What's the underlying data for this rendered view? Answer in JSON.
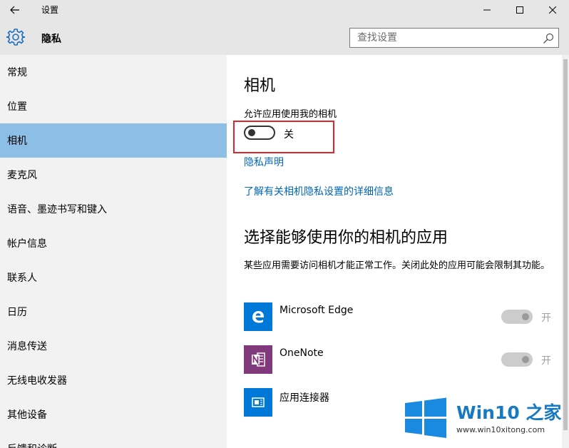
{
  "window": {
    "title": "设置",
    "icons": {
      "back": "back-arrow-icon",
      "minimize": "minimize-icon",
      "maximize": "maximize-icon",
      "close": "close-icon"
    }
  },
  "header": {
    "title": "隐私",
    "icon": "gear-icon",
    "search_placeholder": "查找设置"
  },
  "sidebar": {
    "items": [
      {
        "label": "常规",
        "active": false
      },
      {
        "label": "位置",
        "active": false
      },
      {
        "label": "相机",
        "active": true
      },
      {
        "label": "麦克风",
        "active": false
      },
      {
        "label": "语音、墨迹书写和键入",
        "active": false
      },
      {
        "label": "帐户信息",
        "active": false
      },
      {
        "label": "联系人",
        "active": false
      },
      {
        "label": "日历",
        "active": false
      },
      {
        "label": "消息传送",
        "active": false
      },
      {
        "label": "无线电收发器",
        "active": false
      },
      {
        "label": "其他设备",
        "active": false
      },
      {
        "label": "反馈和诊断",
        "active": false
      }
    ]
  },
  "main": {
    "title": "相机",
    "setting_label": "允许应用使用我的相机",
    "toggle_state": "关",
    "toggle_on": false,
    "link_privacy": "隐私声明",
    "link_details": "了解有关相机隐私设置的详细信息",
    "apps_title": "选择能够使用你的相机的应用",
    "apps_desc": "某些应用需要访问相机才能正常工作。关闭此处的应用可能会限制其功能。",
    "apps": [
      {
        "name": "Microsoft Edge",
        "icon": "edge-icon",
        "color": "#0078d7",
        "toggle_state": "开",
        "has_toggle": true
      },
      {
        "name": "OneNote",
        "icon": "onenote-icon",
        "color": "#80397b",
        "toggle_state": "开",
        "has_toggle": true
      },
      {
        "name": "应用连接器",
        "icon": "app-connector-icon",
        "color": "#0078d7",
        "has_toggle": false
      }
    ]
  },
  "colors": {
    "accent": "#0067b8",
    "active_nav": "#8cbee6",
    "highlight_box": "#e0242a"
  },
  "watermark": {
    "brand": "Win10 之家",
    "url": "www.win10xitong.com"
  }
}
